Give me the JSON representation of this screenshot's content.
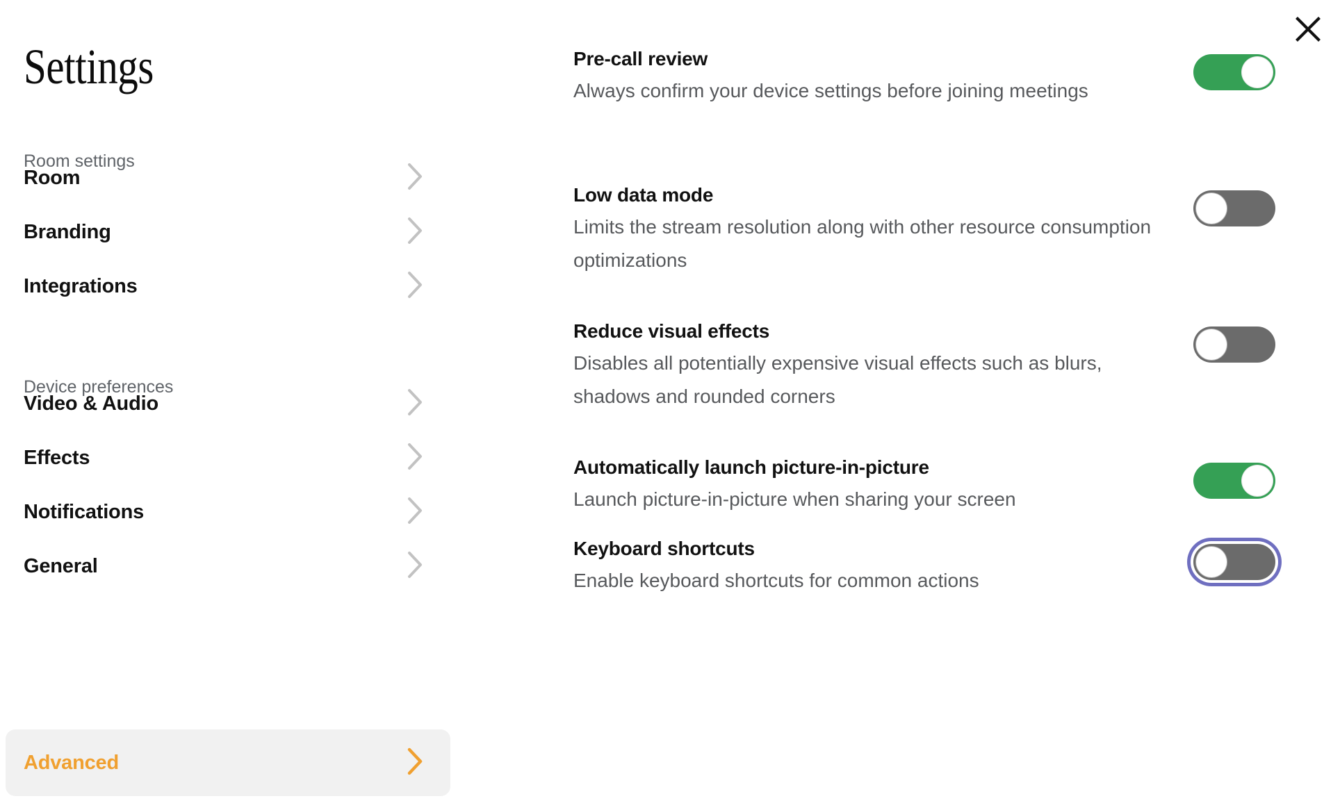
{
  "window": {
    "title": "Settings",
    "close_label": "×",
    "close_icon": "close-icon"
  },
  "colors": {
    "accent_active": "#f0a030",
    "toggle_on": "#35a055",
    "toggle_off": "#6b6b6b",
    "focus_ring": "#6f6fc0",
    "active_row_bg": "#f1f1f1",
    "chevron": "#c2c2c2",
    "section_label": "#5f6368",
    "body_text": "#57595c"
  },
  "sidebar": {
    "sections": [
      {
        "label": "Room settings",
        "items": [
          {
            "label": "Room",
            "icon": "chevron-right-icon",
            "active": false
          },
          {
            "label": "Branding",
            "icon": "chevron-right-icon",
            "active": false
          },
          {
            "label": "Integrations",
            "icon": "chevron-right-icon",
            "active": false
          }
        ]
      },
      {
        "label": "Device preferences",
        "items": [
          {
            "label": "Video & Audio",
            "icon": "chevron-right-icon",
            "active": false
          },
          {
            "label": "Effects",
            "icon": "chevron-right-icon",
            "active": false
          },
          {
            "label": "Notifications",
            "icon": "chevron-right-icon",
            "active": false
          },
          {
            "label": "General",
            "icon": "chevron-right-icon",
            "active": false
          },
          {
            "label": "Advanced",
            "icon": "chevron-right-icon",
            "active": true
          }
        ]
      }
    ]
  },
  "main": {
    "settings": [
      {
        "title": "Pre-call review",
        "description": "Always confirm your device settings before joining meetings",
        "toggle_state": "on",
        "focused": false
      },
      {
        "title": "Low data mode",
        "description": "Limits the stream resolution along with other resource consumption optimizations",
        "toggle_state": "off",
        "focused": false
      },
      {
        "title": "Reduce visual effects",
        "description": "Disables all potentially expensive visual effects such as blurs, shadows and rounded corners",
        "toggle_state": "off",
        "focused": false
      },
      {
        "title": "Automatically launch picture-in-picture",
        "description": "Launch picture-in-picture when sharing your screen",
        "toggle_state": "on",
        "focused": false
      },
      {
        "title": "Keyboard shortcuts",
        "description": "Enable keyboard shortcuts for common actions",
        "toggle_state": "off",
        "focused": true
      }
    ]
  }
}
